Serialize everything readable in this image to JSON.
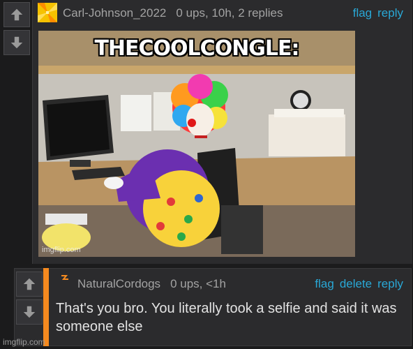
{
  "comment1": {
    "username": "Carl-Johnson_2022",
    "stats": "0 ups, 10h, 2 replies",
    "actions": [
      "flag",
      "reply"
    ],
    "image": {
      "caption": "THECOOLCONGLE:",
      "watermark": "imgflip.com"
    }
  },
  "comment2": {
    "username": "NaturalCordogs",
    "stats": "0 ups, <1h",
    "actions": [
      "flag",
      "delete",
      "reply"
    ],
    "text": "That's you bro. You literally took a selfie and said it was someone else",
    "accent_color": "#f58a1f"
  },
  "footer": {
    "watermark": "imgflip.com"
  },
  "colors": {
    "link": "#29a8d6",
    "background": "#1b1b1c",
    "panel": "#2b2b2d"
  },
  "icons": [
    "upvote-arrow-icon",
    "downvote-arrow-icon"
  ]
}
